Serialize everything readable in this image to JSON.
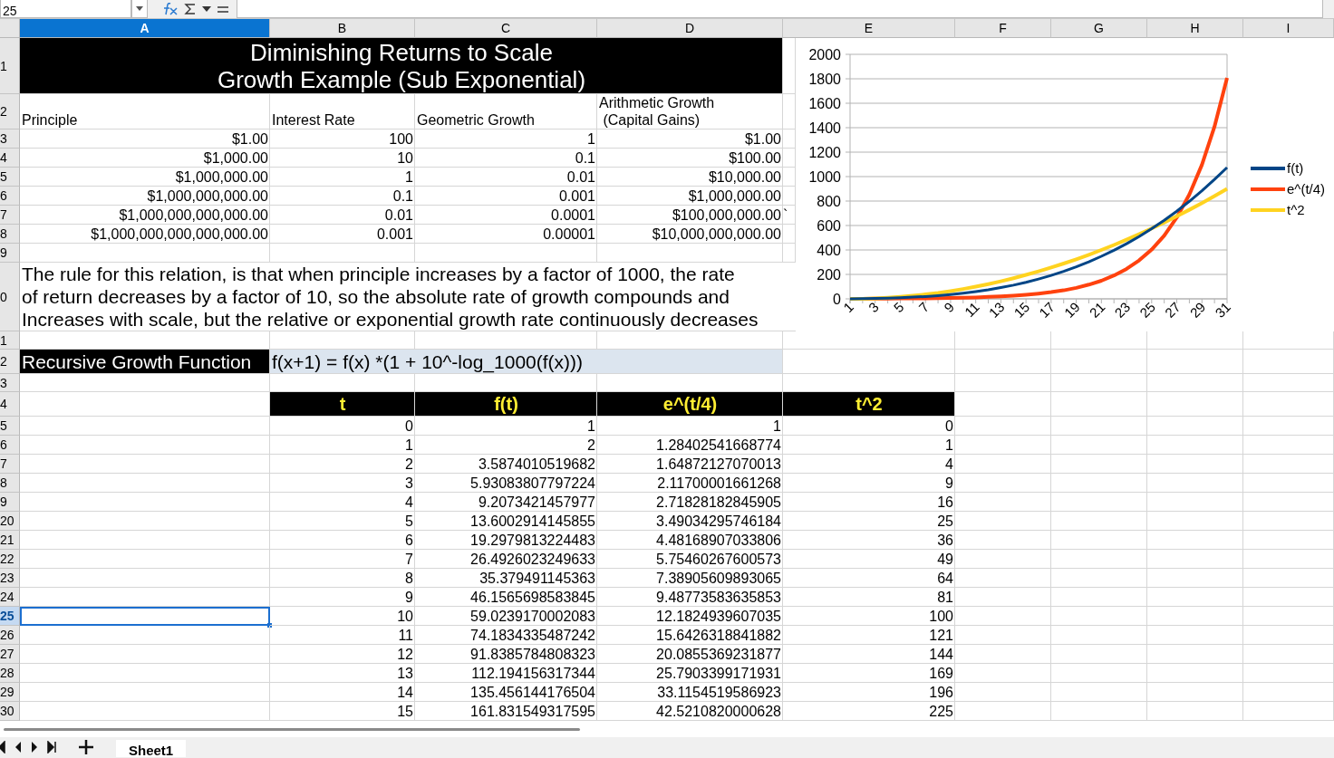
{
  "formula_bar": {
    "name_box": "25"
  },
  "columns": [
    {
      "label": "A",
      "selected": true
    },
    {
      "label": "B",
      "selected": false
    },
    {
      "label": "C",
      "selected": false
    },
    {
      "label": "D",
      "selected": false
    },
    {
      "label": "E",
      "selected": false
    },
    {
      "label": "F",
      "selected": false
    },
    {
      "label": "G",
      "selected": false
    },
    {
      "label": "H",
      "selected": false
    },
    {
      "label": "I",
      "selected": false
    }
  ],
  "row_headers": [
    {
      "label": "1",
      "selected": false
    },
    {
      "label": "2",
      "selected": false
    },
    {
      "label": "3",
      "selected": false
    },
    {
      "label": "4",
      "selected": false
    },
    {
      "label": "5",
      "selected": false
    },
    {
      "label": "6",
      "selected": false
    },
    {
      "label": "7",
      "selected": false
    },
    {
      "label": "8",
      "selected": false
    },
    {
      "label": "9",
      "selected": false
    },
    {
      "label": "0",
      "selected": false
    },
    {
      "label": "1",
      "selected": false
    },
    {
      "label": "2",
      "selected": false
    },
    {
      "label": "3",
      "selected": false
    },
    {
      "label": "4",
      "selected": false
    },
    {
      "label": "5",
      "selected": false
    },
    {
      "label": "6",
      "selected": false
    },
    {
      "label": "7",
      "selected": false
    },
    {
      "label": "8",
      "selected": false
    },
    {
      "label": "9",
      "selected": false
    },
    {
      "label": "20",
      "selected": false
    },
    {
      "label": "21",
      "selected": false
    },
    {
      "label": "22",
      "selected": false
    },
    {
      "label": "23",
      "selected": false
    },
    {
      "label": "24",
      "selected": false
    },
    {
      "label": "25",
      "selected": true
    },
    {
      "label": "26",
      "selected": false
    },
    {
      "label": "27",
      "selected": false
    },
    {
      "label": "28",
      "selected": false
    },
    {
      "label": "29",
      "selected": false
    },
    {
      "label": "30",
      "selected": false
    }
  ],
  "title": [
    "Diminishing Returns to Scale",
    "Growth Example (Sub Exponential)"
  ],
  "scale_table": {
    "headers": [
      "Principle",
      "Interest Rate",
      "Geometric Growth",
      "Arithmetic Growth\n (Capital Gains)"
    ],
    "rows": [
      [
        "$1.00",
        "100",
        "1",
        "$1.00"
      ],
      [
        "$1,000.00",
        "10",
        "0.1",
        "$100.00"
      ],
      [
        "$1,000,000.00",
        "1",
        "0.01",
        "$10,000.00"
      ],
      [
        "$1,000,000,000.00",
        "0.1",
        "0.001",
        "$1,000,000.00"
      ],
      [
        "$1,000,000,000,000.00",
        "0.01",
        "0.0001",
        "$100,000,000.00",
        "`"
      ],
      [
        "$1,000,000,000,000,000.00",
        "0.001",
        "0.00001",
        "$10,000,000,000.00"
      ]
    ]
  },
  "note": [
    "The rule for this relation, is that when principle increases by a factor of 1000, the rate",
    "of return decreases by a factor of 10, so the absolute rate of growth compounds and",
    "Increases with scale, but the relative or exponential growth rate continuously decreases"
  ],
  "function_label": "Recursive Growth Function",
  "function_formula": "f(x+1) = f(x) *(1 + 10^-log_1000(f(x)))",
  "growth_table": {
    "headers": [
      "t",
      "f(t)",
      "e^(t/4)",
      "t^2"
    ],
    "rows": [
      [
        "0",
        "1",
        "1",
        "0"
      ],
      [
        "1",
        "2",
        "1.28402541668774",
        "1"
      ],
      [
        "2",
        "3.5874010519682",
        "1.64872127070013",
        "4"
      ],
      [
        "3",
        "5.93083807797224",
        "2.11700001661268",
        "9"
      ],
      [
        "4",
        "9.2073421457977",
        "2.71828182845905",
        "16"
      ],
      [
        "5",
        "13.6002914145855",
        "3.49034295746184",
        "25"
      ],
      [
        "6",
        "19.2979813224483",
        "4.48168907033806",
        "36"
      ],
      [
        "7",
        "26.4926023249633",
        "5.75460267600573",
        "49"
      ],
      [
        "8",
        "35.379491145363",
        "7.38905609893065",
        "64"
      ],
      [
        "9",
        "46.1565698583845",
        "9.48773583635853",
        "81"
      ],
      [
        "10",
        "59.0239170002083",
        "12.1824939607035",
        "100"
      ],
      [
        "11",
        "74.1834335487242",
        "15.6426318841882",
        "121"
      ],
      [
        "12",
        "91.8385784808323",
        "20.0855369231877",
        "144"
      ],
      [
        "13",
        "112.194156317344",
        "25.7903399171931",
        "169"
      ],
      [
        "14",
        "135.456144176504",
        "33.1154519586923",
        "196"
      ],
      [
        "15",
        "161.831549317595",
        "42.5210820000628",
        "225"
      ]
    ]
  },
  "chart_data": {
    "type": "line",
    "x": [
      1,
      2,
      3,
      4,
      5,
      6,
      7,
      8,
      9,
      10,
      11,
      12,
      13,
      14,
      15,
      16,
      17,
      18,
      19,
      20,
      21,
      22,
      23,
      24,
      25,
      26,
      27,
      28,
      29,
      30,
      31
    ],
    "xlim": [
      1,
      31
    ],
    "xticks": [
      {
        "value": 1,
        "label": "1"
      },
      {
        "value": 3,
        "label": "3"
      },
      {
        "value": 5,
        "label": "5"
      },
      {
        "value": 7,
        "label": "7"
      },
      {
        "value": 9,
        "label": "9"
      },
      {
        "value": 11,
        "label": "11"
      },
      {
        "value": 13,
        "label": "13"
      },
      {
        "value": 15,
        "label": "15"
      },
      {
        "value": 17,
        "label": "17"
      },
      {
        "value": 19,
        "label": "19"
      },
      {
        "value": 21,
        "label": "21"
      },
      {
        "value": 23,
        "label": "23"
      },
      {
        "value": 25,
        "label": "25"
      },
      {
        "value": 27,
        "label": "27"
      },
      {
        "value": 29,
        "label": "29"
      },
      {
        "value": 31,
        "label": "31"
      }
    ],
    "ylim": [
      0,
      2000
    ],
    "yticks": [
      0,
      200,
      400,
      600,
      800,
      1000,
      1200,
      1400,
      1600,
      1800,
      2000
    ],
    "grid": true,
    "legend": true,
    "series": [
      {
        "name": "f(t)",
        "color": "#004586",
        "values": [
          1,
          2,
          4,
          6,
          9,
          14,
          19,
          26,
          35,
          46,
          59,
          74,
          92,
          112,
          135,
          162,
          192,
          225,
          262,
          303,
          348,
          397,
          451,
          510,
          574,
          643,
          717,
          798,
          884,
          976,
          1074
        ]
      },
      {
        "name": "e^(t/4)",
        "color": "#ff420e",
        "values": [
          1,
          1,
          2,
          2,
          3,
          3,
          4,
          6,
          7,
          9,
          12,
          16,
          20,
          26,
          33,
          43,
          55,
          70,
          90,
          116,
          148,
          191,
          245,
          314,
          403,
          518,
          665,
          854,
          1097,
          1408,
          1808
        ]
      },
      {
        "name": "t^2",
        "color": "#ffd320",
        "values": [
          0,
          1,
          4,
          9,
          16,
          25,
          36,
          49,
          64,
          81,
          100,
          121,
          144,
          169,
          196,
          225,
          256,
          289,
          324,
          361,
          400,
          441,
          484,
          529,
          576,
          625,
          676,
          729,
          784,
          841,
          900
        ]
      }
    ]
  },
  "sheet_tabs": [
    {
      "label": "Sheet1",
      "selected": true
    }
  ]
}
